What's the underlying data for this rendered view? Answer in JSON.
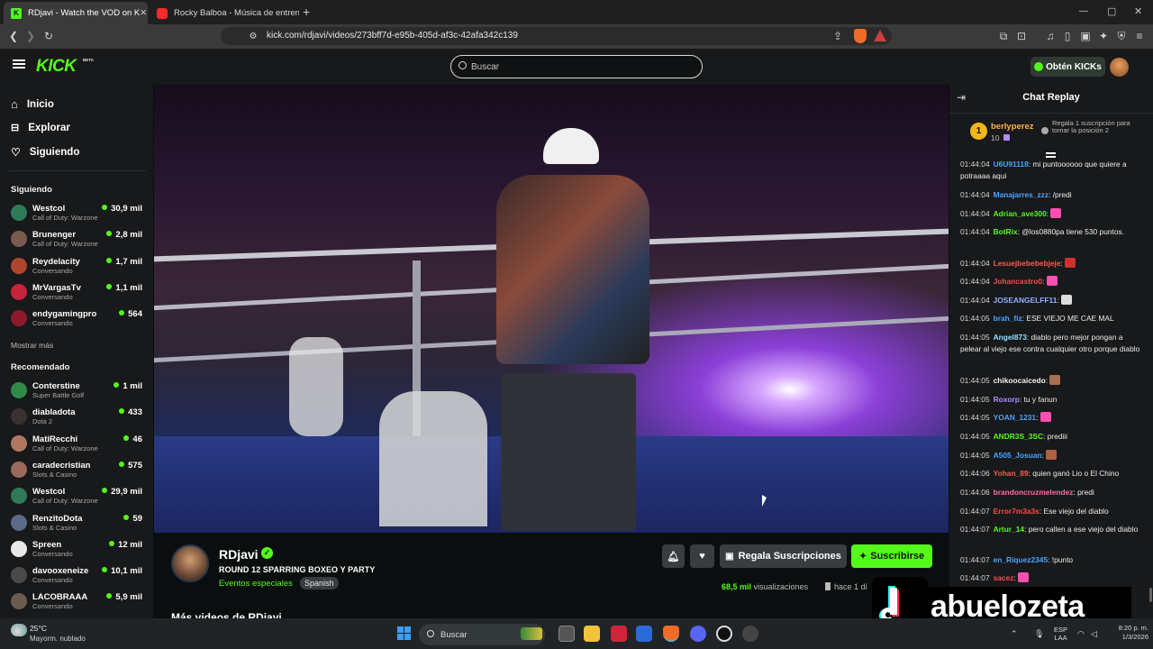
{
  "browser": {
    "tabs": [
      {
        "title": "RDjavi - Watch the VOD on K",
        "active": true
      },
      {
        "title": "Rocky Balboa - Música de entrenam",
        "active": false
      }
    ],
    "new_tab": "+",
    "url": "kick.com/rdjavi/videos/273bff7d-e95b-405d-af3c-42afa342c139",
    "window_controls": [
      "—",
      "▢",
      "✕"
    ]
  },
  "header": {
    "logo": "KICK",
    "logo_badge": "BETA",
    "search_placeholder": "Buscar",
    "get_kicks": "Obtén KICKs"
  },
  "sidebar": {
    "nav": [
      {
        "label": "Inicio",
        "icon": "home-icon"
      },
      {
        "label": "Explorar",
        "icon": "compass-icon"
      },
      {
        "label": "Siguiendo",
        "icon": "heart-icon"
      }
    ],
    "following_title": "Siguiendo",
    "following": [
      {
        "name": "Westcol",
        "sub": "Call of Duty: Warzone",
        "viewers": "30,9 mil",
        "color": "#2f7a57"
      },
      {
        "name": "Brunenger",
        "sub": "Call of Duty: Warzone",
        "viewers": "2,8 mil",
        "color": "#7a5b4f"
      },
      {
        "name": "Reydelacity",
        "sub": "Conversando",
        "viewers": "1,7 mil",
        "color": "#b0452f"
      },
      {
        "name": "MrVargasTv",
        "sub": "Conversando",
        "viewers": "1,1 mil",
        "color": "#c7233a"
      },
      {
        "name": "endygamingpro",
        "sub": "Conversando",
        "viewers": "564",
        "color": "#8d1b2c"
      }
    ],
    "show_more": "Mostrar más",
    "recommended_title": "Recomendado",
    "recommended": [
      {
        "name": "Conterstine",
        "sub": "Super Battle Golf",
        "viewers": "1 mil",
        "color": "#2f8a4a"
      },
      {
        "name": "diabladota",
        "sub": "Dota 2",
        "viewers": "433",
        "color": "#3a3030"
      },
      {
        "name": "MatiRecchi",
        "sub": "Call of Duty: Warzone",
        "viewers": "46",
        "color": "#b07760"
      },
      {
        "name": "caradecristian",
        "sub": "Slots & Casino",
        "viewers": "575",
        "color": "#9b6a5a"
      },
      {
        "name": "Westcol",
        "sub": "Call of Duty: Warzone",
        "viewers": "29,9 mil",
        "color": "#2f7a57"
      },
      {
        "name": "RenzitoDota",
        "sub": "Slots & Casino",
        "viewers": "59",
        "color": "#5a6a88"
      },
      {
        "name": "Spreen",
        "sub": "Conversando",
        "viewers": "12 mil",
        "color": "#e8e8e8"
      },
      {
        "name": "davooxeneize",
        "sub": "Conversando",
        "viewers": "10,1 mil",
        "color": "#4a4a4a"
      },
      {
        "name": "LACOBRAAA",
        "sub": "Conversando",
        "viewers": "5,9 mil",
        "color": "#6a5a50"
      }
    ]
  },
  "stream": {
    "channel": "RDjavi",
    "title": "ROUND 12 SPARRING  BOXEO Y PARTY",
    "category": "Eventos especiales",
    "language": "Spanish",
    "gift_label": "Regala Suscripciones",
    "subscribe_label": "Suscribirse",
    "views_number": "68,5 mil",
    "views_label": "visualizaciones",
    "ago": "hace 1 dí",
    "more_videos": "Más videos de RDjavi"
  },
  "chat": {
    "title": "Chat Replay",
    "top_gifter": {
      "rank": "1",
      "name": "berlyperez",
      "count": "10",
      "promo": "Regala 1 suscripción para tomar la posición 2"
    },
    "messages": [
      {
        "time": "01:44:04",
        "user": "U6U91118",
        "color": "#4aa3ff",
        "text": ": mi puntoooooo que quiere a potraaaa aqui"
      },
      {
        "time": "01:44:04",
        "user": "Manajarres_zzz",
        "color": "#4aa3ff",
        "text": ": /predi"
      },
      {
        "time": "01:44:04",
        "user": "Adrian_ave300",
        "color": "#53fc18",
        "text": ":",
        "emote": "#ff4fb0"
      },
      {
        "time": "01:44:04",
        "user": "BotRix",
        "color": "#53fc18",
        "text": ": @los0880pa tiene 530 puntos."
      },
      {
        "time": "01:44:04",
        "user": "Lesuejbebebebjeje",
        "color": "#ff5a4a",
        "text": ":",
        "emote": "#d03030"
      },
      {
        "time": "01:44:04",
        "user": "Johancastro0",
        "color": "#ff4a4a",
        "text": ":",
        "emote": "#ff4fb0"
      },
      {
        "time": "01:44:04",
        "user": "JOSEANGELFF11",
        "color": "#8fb0ff",
        "text": ":",
        "emote": "#dddddd"
      },
      {
        "time": "01:44:05",
        "user": "brah_fiz",
        "color": "#4aa3ff",
        "text": ": ESE VIEJO ME CAE MAL"
      },
      {
        "time": "01:44:05",
        "user": "Angel873",
        "color": "#8fe0ff",
        "text": ": diablo pero mejor pongan a pelear al viejo ese contra cualquier otro porque diablo"
      },
      {
        "time": "01:44:05",
        "user": "chikoocaicedo",
        "color": "#f0f0f0",
        "text": ":",
        "emote": "#a87050"
      },
      {
        "time": "01:44:05",
        "user": "Roxorp",
        "color": "#b08cff",
        "text": ": tu y fanun"
      },
      {
        "time": "01:44:05",
        "user": "YOAN_1231",
        "color": "#4aa3ff",
        "text": ":",
        "emote": "#ff4fb0"
      },
      {
        "time": "01:44:05",
        "user": "ANDR3S_3SC",
        "color": "#53fc18",
        "text": ": prediii"
      },
      {
        "time": "01:44:05",
        "user": "A505_Josuan",
        "color": "#4aa3ff",
        "text": ":",
        "emote": "#b06040"
      },
      {
        "time": "01:44:06",
        "user": "Yohan_89",
        "color": "#ff5a4a",
        "text": ": quien ganó Lio o El Chino"
      },
      {
        "time": "01:44:06",
        "user": "brandoncruzmelendez",
        "color": "#ff6aa0",
        "text": ": predi"
      },
      {
        "time": "01:44:07",
        "user": "Error7m3a3s",
        "color": "#ff4a4a",
        "text": ": Ese viejo del diablo"
      },
      {
        "time": "01:44:07",
        "user": "Artur_14",
        "color": "#53fc18",
        "text": ": pero callen a ese viejo del diablo"
      },
      {
        "time": "01:44:07",
        "user": "en_Riquez2345",
        "color": "#4aa3ff",
        "text": ": !punto"
      },
      {
        "time": "01:44:07",
        "user": "sacez",
        "color": "#ff4a4a",
        "text": ":",
        "emote": "#ff4fb0"
      }
    ]
  },
  "watermark": "abuelozeta_",
  "taskbar": {
    "weather_temp": "25°C",
    "weather_desc": "Mayorm. nublado",
    "search": "Buscar",
    "lang_top": "ESP",
    "lang_bottom": "LAA",
    "time": "8:20 p. m.",
    "date": "1/3/2026"
  }
}
